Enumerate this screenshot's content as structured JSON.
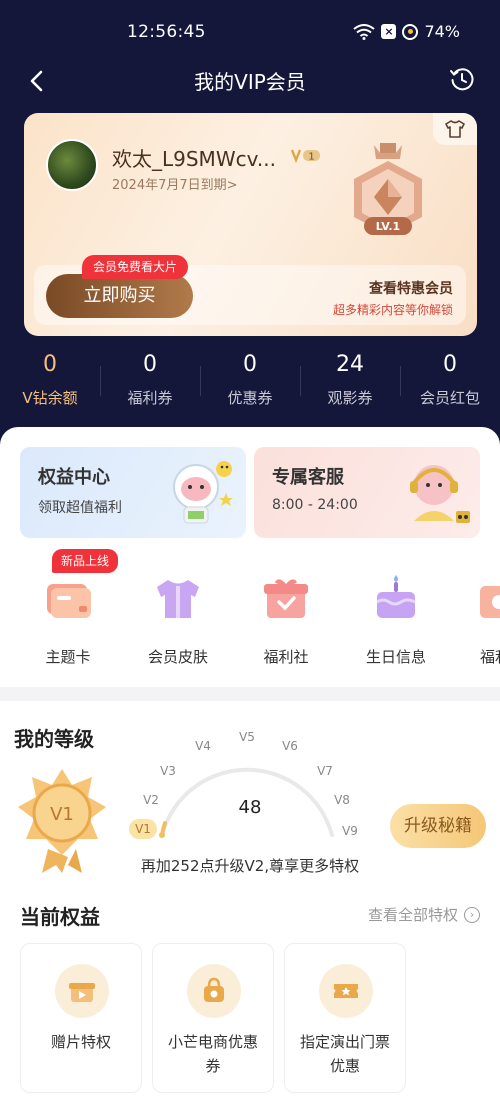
{
  "status": {
    "time": "12:56:45",
    "battery": "74%"
  },
  "nav": {
    "title": "我的VIP会员"
  },
  "card": {
    "username": "欢太_L9SMWcv...",
    "vip_level_badge": "1",
    "expiry": "2024年7月7日到期>",
    "medal_label": "LV.1",
    "free_tag": "会员免费看大片",
    "buy_label": "立即购买",
    "special_title": "查看特惠会员",
    "special_sub": "超多精彩内容等你解锁"
  },
  "stats": [
    {
      "value": "0",
      "label": "V钻余额"
    },
    {
      "value": "0",
      "label": "福利券"
    },
    {
      "value": "0",
      "label": "优惠券"
    },
    {
      "value": "24",
      "label": "观影券"
    },
    {
      "value": "0",
      "label": "会员红包"
    }
  ],
  "features": [
    {
      "title": "权益中心",
      "subtitle": "领取超值福利"
    },
    {
      "title": "专属客服",
      "subtitle": "8:00 - 24:00"
    }
  ],
  "new_tag": "新品上线",
  "shortcuts": [
    {
      "label": "主题卡",
      "icon": "theme-card-icon"
    },
    {
      "label": "会员皮肤",
      "icon": "skin-icon"
    },
    {
      "label": "福利社",
      "icon": "welfare-icon"
    },
    {
      "label": "生日信息",
      "icon": "birthday-icon"
    },
    {
      "label": "福利",
      "icon": "welfare-partial-icon"
    }
  ],
  "level": {
    "title": "我的等级",
    "current_badge": "V1",
    "points": "48",
    "ticks": [
      "V1",
      "V2",
      "V3",
      "V4",
      "V5",
      "V6",
      "V7",
      "V8",
      "V9"
    ],
    "upgrade_label": "升级秘籍",
    "tip": "再加252点升级V2,尊享更多特权"
  },
  "benefits": {
    "title": "当前权益",
    "view_all": "查看全部特权",
    "items": [
      {
        "line1": "赠片特权",
        "line2": ""
      },
      {
        "line1": "小芒电商优惠",
        "line2": "券"
      },
      {
        "line1": "指定演出门票",
        "line2": "优惠"
      }
    ]
  },
  "colors": {
    "header_bg": "#14163a",
    "gold_accent": "#f5c07c",
    "red_tag": "#f0333b"
  }
}
